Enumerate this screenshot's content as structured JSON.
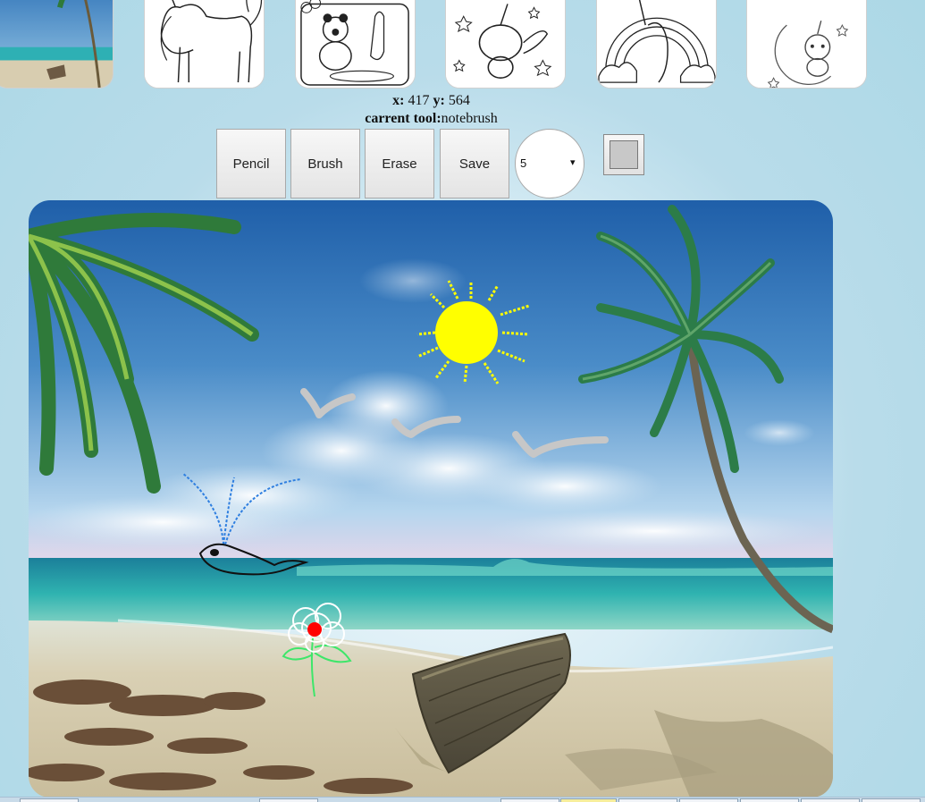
{
  "thumbnails": [
    {
      "name": "beach-scene"
    },
    {
      "name": "unicorn-outline"
    },
    {
      "name": "winnie-the-pooh"
    },
    {
      "name": "winged-unicorn"
    },
    {
      "name": "unicorn-rainbow"
    },
    {
      "name": "unicorn-moon"
    }
  ],
  "readout": {
    "x_label": "x:",
    "x_value": "417",
    "y_label": "y:",
    "y_value": "564",
    "tool_label": "carrent tool:",
    "tool_value": "notebrush"
  },
  "toolbar": {
    "pencil_label": "Pencil",
    "brush_label": "Brush",
    "erase_label": "Erase",
    "save_label": "Save",
    "size_value": "5",
    "size_arrow": "▾",
    "color_value": "#c8c8c8"
  },
  "colors": {
    "page_bg": "#acd8e6",
    "sun": "#ffff00",
    "whale_spout": "#2f7fe0",
    "flower_center": "#ff0000",
    "flower_stem": "#3ee66a",
    "seagull": "#c7c7c7"
  }
}
